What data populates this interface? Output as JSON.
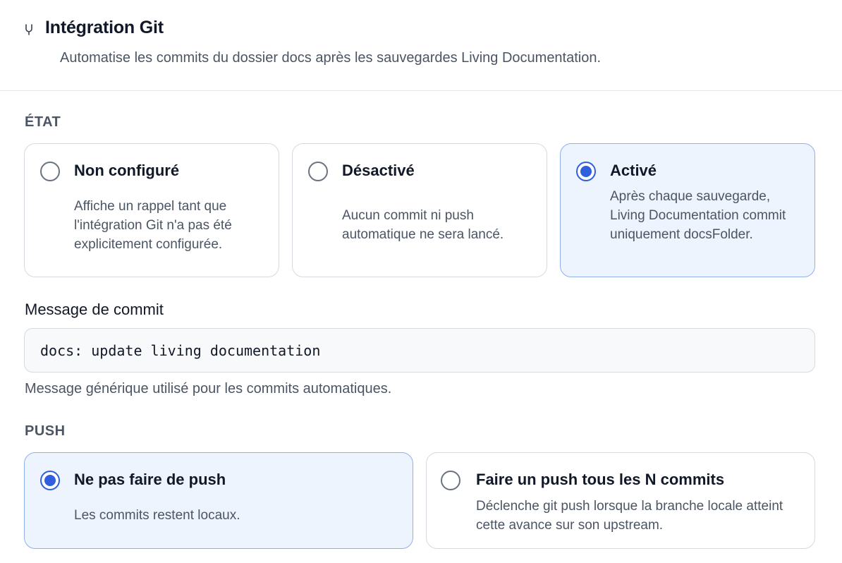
{
  "header": {
    "icon": "git-branch-icon",
    "title": "Intégration Git",
    "subtitle": "Automatise les commits du dossier docs après les sauvegardes Living Documentation."
  },
  "state_section": {
    "label": "ÉTAT",
    "options": [
      {
        "title": "Non configuré",
        "description": "Affiche un rappel tant que l'intégration Git n'a pas été explicitement configurée.",
        "selected": false
      },
      {
        "title": "Désactivé",
        "description": "Aucun commit ni push automatique ne sera lancé.",
        "selected": false
      },
      {
        "title": "Activé",
        "description": "Après chaque sauvegarde, Living Documentation commit uniquement docsFolder.",
        "selected": true
      }
    ]
  },
  "commit_message": {
    "label": "Message de commit",
    "value": "docs: update living documentation",
    "help": "Message générique utilisé pour les commits automatiques."
  },
  "push_section": {
    "label": "PUSH",
    "options": [
      {
        "title": "Ne pas faire de push",
        "description": "Les commits restent locaux.",
        "selected": true
      },
      {
        "title": "Faire un push tous les N commits",
        "description": "Déclenche git push lorsque la branche locale atteint cette avance sur son upstream.",
        "selected": false
      }
    ]
  },
  "colors": {
    "accent": "#2f5fdc",
    "selected_background": "#eef4fe",
    "selected_border": "#8fb0ec",
    "muted_text": "#4b5563"
  }
}
